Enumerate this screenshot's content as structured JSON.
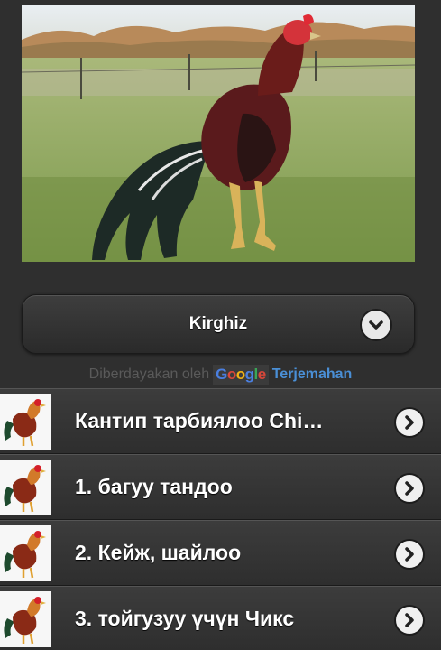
{
  "hero": {
    "image": "rooster-photo"
  },
  "language_select": {
    "selected": "Kirghiz",
    "icon": "chevron-down-icon"
  },
  "powered_by": {
    "text": "Diberdayakan oleh",
    "brand": [
      "G",
      "o",
      "o",
      "g",
      "l",
      "e"
    ],
    "link": "Terjemahan"
  },
  "list": {
    "items": [
      {
        "label": "Кантип тарбиялоо Chi…",
        "icon": "rooster-thumbnail"
      },
      {
        "label": "1. багуу тандоо",
        "icon": "rooster-thumbnail"
      },
      {
        "label": "2. Кейж, шайлоо",
        "icon": "rooster-thumbnail"
      },
      {
        "label": "3. тойгузуу үчүн Чикс",
        "icon": "rooster-thumbnail"
      }
    ],
    "arrow_icon": "chevron-right-icon"
  },
  "colors": {
    "background": "#2f2f2f",
    "link": "#4a8fd6",
    "text": "#ffffff"
  }
}
